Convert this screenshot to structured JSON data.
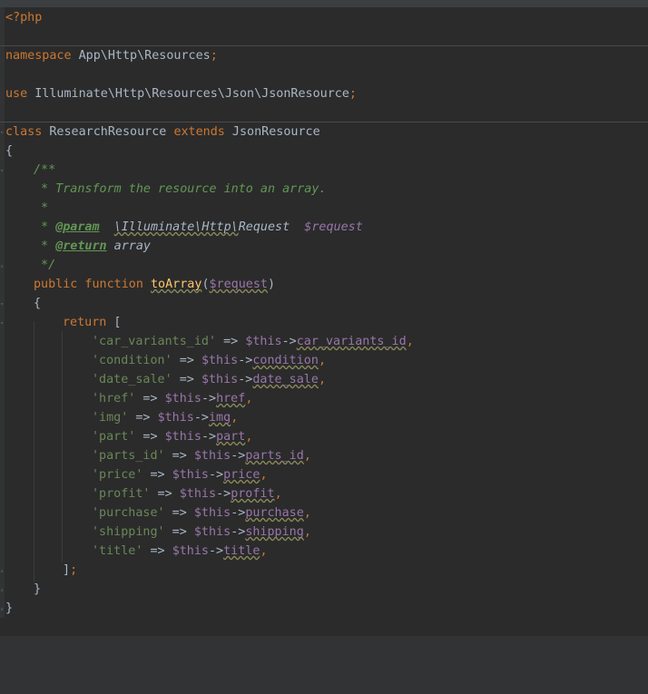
{
  "code": {
    "l1": "<?php",
    "l2_kw": "namespace",
    "l2_ns": " App\\Http\\Resources",
    "semi": ";",
    "l3_kw": "use",
    "l3_ns": " Illuminate\\Http\\Resources\\Json\\JsonResource",
    "l4_kw1": "class",
    "l4_name": " ResearchResource ",
    "l4_kw2": "extends",
    "l4_parent": " JsonResource",
    "brace_open": "{",
    "brace_close": "}",
    "doc_open": "/**",
    "doc_desc": " * Transform the resource into an array.",
    "doc_star": " *",
    "doc_star_sp": " * ",
    "doc_param_tag": "@param",
    "doc_param_sp": "  ",
    "doc_param_type": "\\Illuminate\\Http\\",
    "doc_param_type2": "Request",
    "doc_param_var": "  $request",
    "doc_return_tag": "@return",
    "doc_return_type": " array",
    "doc_close": " */",
    "fn_kw": "public function ",
    "fn_name": "toArray",
    "fn_paren_open": "(",
    "fn_arg": "$request",
    "fn_paren_close": ")",
    "return_kw": "return",
    "return_bracket": " [",
    "arrow": " => ",
    "this": "$this",
    "accessor": "->",
    "comma": ",",
    "array_close": "]",
    "items": [
      {
        "key": "'car_variants_id'",
        "prop": "car_variants_id"
      },
      {
        "key": "'condition'",
        "prop": "condition"
      },
      {
        "key": "'date_sale'",
        "prop": "date_sale"
      },
      {
        "key": "'href'",
        "prop": "href"
      },
      {
        "key": "'img'",
        "prop": "img"
      },
      {
        "key": "'part'",
        "prop": "part"
      },
      {
        "key": "'parts_id'",
        "prop": "parts_id"
      },
      {
        "key": "'price'",
        "prop": "price"
      },
      {
        "key": "'profit'",
        "prop": "profit"
      },
      {
        "key": "'purchase'",
        "prop": "purchase"
      },
      {
        "key": "'shipping'",
        "prop": "shipping"
      },
      {
        "key": "'title'",
        "prop": "title"
      }
    ]
  },
  "colors": {
    "background": "#2b2b2b",
    "keyword": "#cc7832",
    "string": "#6a8759",
    "variable": "#9876aa",
    "function": "#ffc66d",
    "doc": "#629755",
    "text": "#a9b7c6"
  }
}
